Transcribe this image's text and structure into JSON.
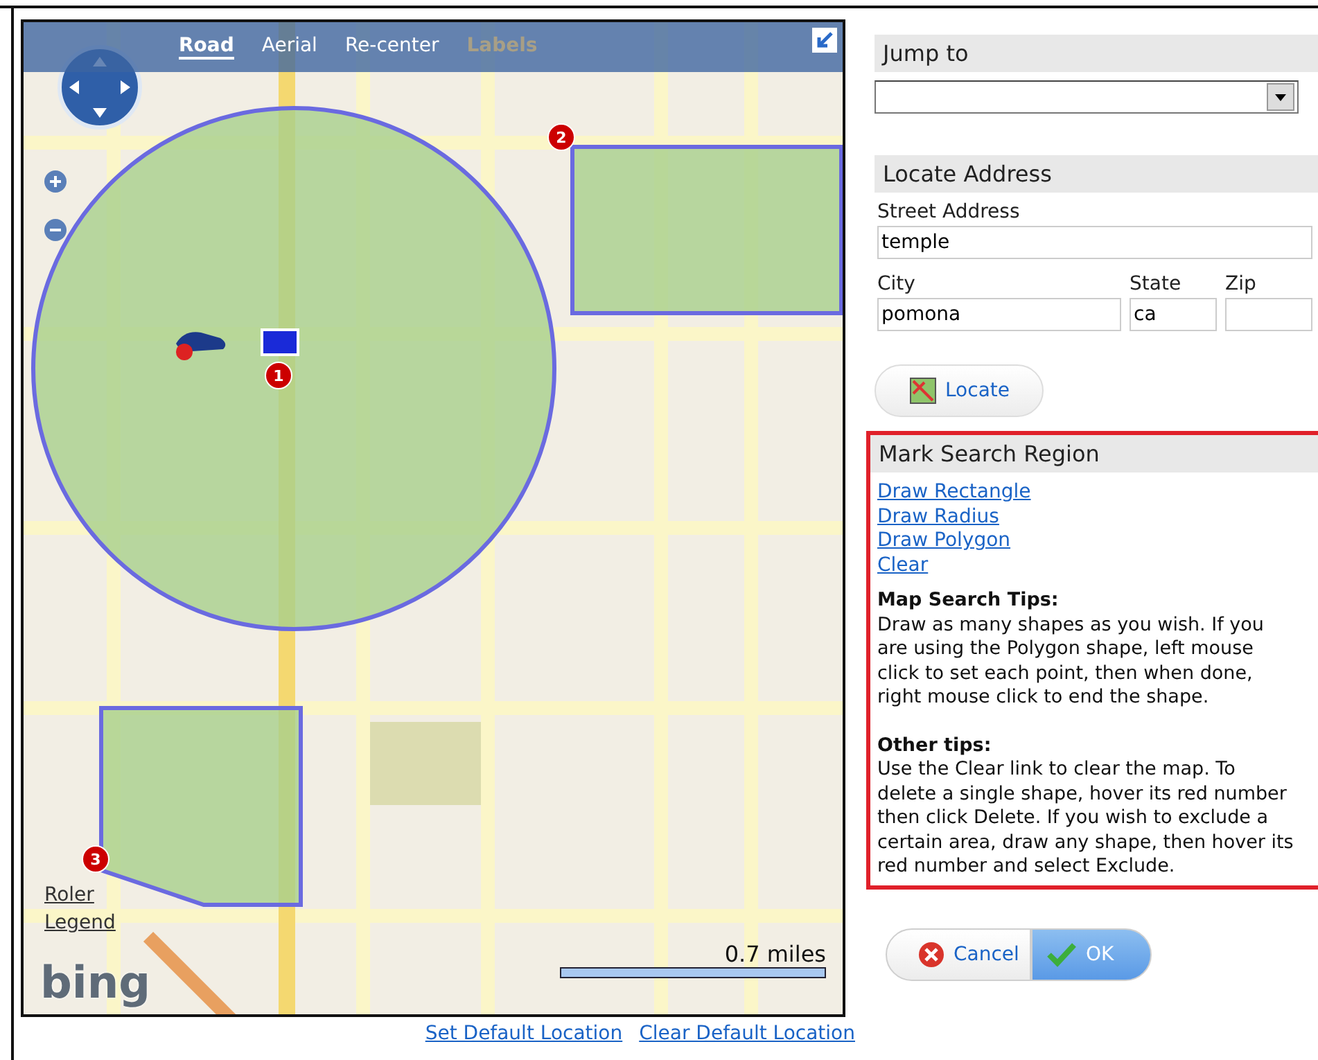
{
  "map": {
    "tabs": [
      {
        "label": "Road",
        "selected": true,
        "disabled": false
      },
      {
        "label": "Aerial",
        "selected": false,
        "disabled": false
      },
      {
        "label": "Re-center",
        "selected": false,
        "disabled": false
      },
      {
        "label": "Labels",
        "selected": false,
        "disabled": true
      }
    ],
    "markers": [
      {
        "label": "1"
      },
      {
        "label": "2"
      },
      {
        "label": "3"
      }
    ],
    "links": [
      "Roler",
      "Legend"
    ],
    "logo": "bing",
    "scale": "0.7 miles"
  },
  "map_links": [
    "Set Default Location",
    "Clear Default Location"
  ],
  "jump_to": {
    "title": "Jump to"
  },
  "locate_address": {
    "title": "Locate Address",
    "fields": [
      {
        "label": "Street Address",
        "value": "temple"
      },
      {
        "label": "City",
        "value": "pomona"
      },
      {
        "label": "State",
        "value": "ca"
      },
      {
        "label": "Zip"
      }
    ],
    "button": "Locate"
  },
  "mark_search_region": {
    "title": "Mark Search Region",
    "links": [
      "Draw Rectangle",
      "Draw Radius",
      "Draw Polygon",
      "Clear"
    ],
    "sections": [
      {
        "heading": "Map Search Tips:",
        "text": "Draw as many shapes as you wish. If you are using the Polygon shape, left mouse click to set each point, then when done, right mouse click to end the shape."
      },
      {
        "heading": "Other tips:",
        "text": "Use the Clear link to clear the map. To delete a single shape, hover its red number then click Delete. If you wish to exclude a certain area, draw any shape, then hover its red number and select Exclude."
      }
    ]
  },
  "buttons": [
    {
      "label": "Cancel",
      "kind": "cancel"
    },
    {
      "label": "OK",
      "kind": "ok"
    }
  ]
}
